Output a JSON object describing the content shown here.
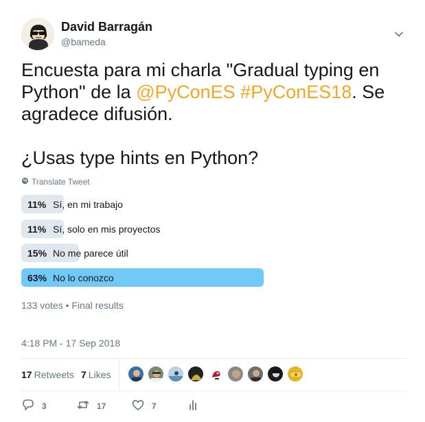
{
  "author": {
    "name": "David Barragán",
    "handle": "@bameda"
  },
  "tweet": {
    "line1": "Encuesta para mi charla \"Gradual typing en",
    "line2_pre": "Python\" de la ",
    "mention": "@PyConES",
    "hashtag": "#PyConES18",
    "line2_post": ". Se",
    "line3": "agradece difusión.",
    "question": "¿Usas type hints en Python?"
  },
  "translate_label": "Translate Tweet",
  "poll": {
    "options": [
      {
        "percent_label": "11%",
        "percent": 11,
        "label": "Sí, en mi trabajo"
      },
      {
        "percent_label": "11%",
        "percent": 11,
        "label": "Sí, solo en mis proyectos"
      },
      {
        "percent_label": "15%",
        "percent": 15,
        "label": "No me parece útil"
      },
      {
        "percent_label": "63%",
        "percent": 63,
        "label": "No lo conozco"
      }
    ],
    "votes": "133 votes",
    "bullet": "•",
    "status": "Final results"
  },
  "timestamp": "4:18 PM - 17 Sep 2018",
  "stats": {
    "retweets_count": "17",
    "retweets_label": "Retweets",
    "likes_count": "7",
    "likes_label": "Likes"
  },
  "actions": {
    "reply_count": "3",
    "retweet_count": "17",
    "like_count": "7"
  },
  "colors": {
    "link": "#f5a623",
    "winner_bar": "#71c9f8",
    "bar": "#e1e8ed",
    "muted": "#657786"
  },
  "icons": [
    "chevron-down-icon",
    "globe-icon",
    "reply-icon",
    "retweet-icon",
    "heart-icon",
    "analytics-icon"
  ]
}
